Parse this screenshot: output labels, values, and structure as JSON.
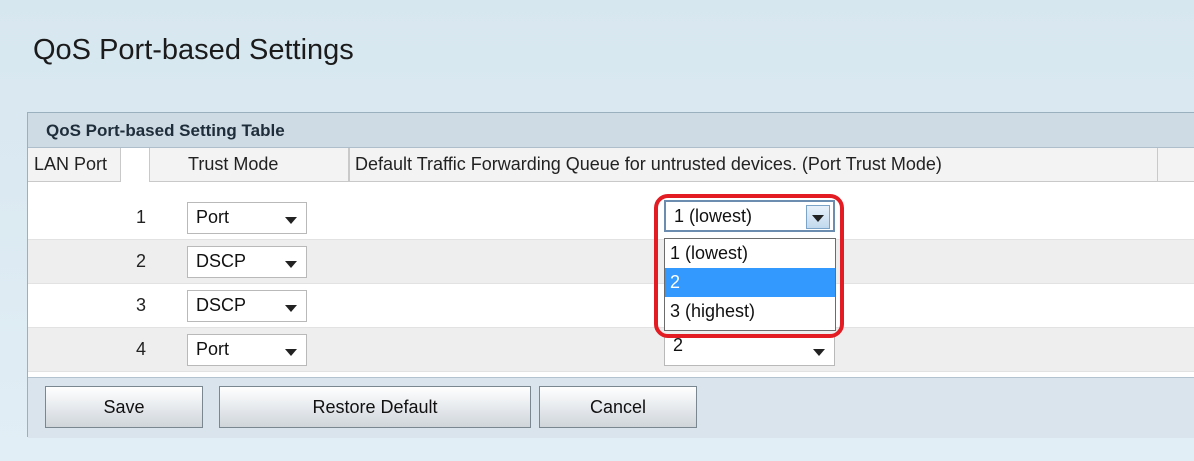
{
  "page": {
    "title": "QoS Port-based Settings"
  },
  "table": {
    "heading": "QoS Port-based Setting Table",
    "columns": [
      "LAN Port",
      "Trust Mode",
      "Default Traffic Forwarding Queue for untrusted devices. (Port Trust Mode)"
    ],
    "rows": [
      {
        "port": "1",
        "trust_mode": "Port",
        "queue": "1 (lowest)"
      },
      {
        "port": "2",
        "trust_mode": "DSCP",
        "queue": ""
      },
      {
        "port": "3",
        "trust_mode": "DSCP",
        "queue": ""
      },
      {
        "port": "4",
        "trust_mode": "Port",
        "queue": "2"
      }
    ]
  },
  "dropdown": {
    "options": [
      "1 (lowest)",
      "2",
      "3 (highest)"
    ],
    "highlighted_index": 1
  },
  "buttons": {
    "save": "Save",
    "restore": "Restore Default",
    "cancel": "Cancel"
  },
  "colors": {
    "highlight": "#3399ff",
    "callout": "#e31b23"
  },
  "icons": {
    "select_arrow": "chevron-down-icon"
  }
}
